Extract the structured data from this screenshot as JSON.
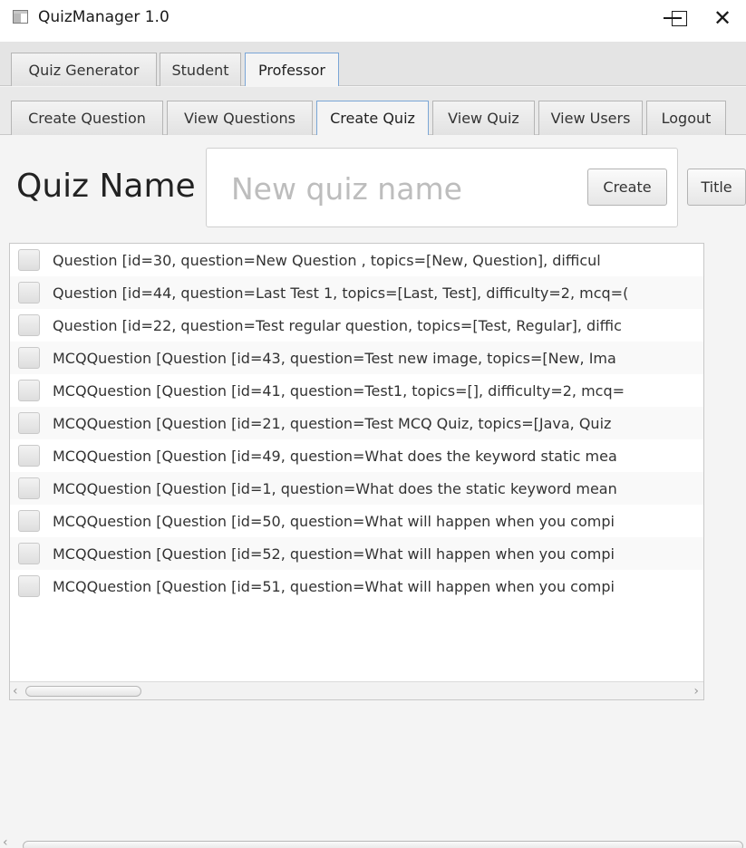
{
  "window": {
    "title": "QuizManager 1.0",
    "minimize": "—",
    "close": "✕"
  },
  "tabs": [
    {
      "label": "Quiz Generator"
    },
    {
      "label": "Student"
    },
    {
      "label": "Professor"
    }
  ],
  "subtabs": [
    {
      "label": "Create Question"
    },
    {
      "label": "View Questions"
    },
    {
      "label": "Create Quiz"
    },
    {
      "label": "View Quiz"
    },
    {
      "label": "View Users"
    },
    {
      "label": "Logout"
    }
  ],
  "quiz": {
    "label": "Quiz Name",
    "placeholder": "New quiz name",
    "value": "",
    "create_label": "Create",
    "title_label": "Title"
  },
  "questions": [
    "Question [id=30, question=New Question    , topics=[New, Question], difficul",
    "Question [id=44, question=Last Test 1, topics=[Last, Test], difficulty=2, mcq=(",
    "Question [id=22, question=Test regular question, topics=[Test, Regular], diffic",
    "MCQQuestion [Question [id=43, question=Test new image, topics=[New, Ima",
    "MCQQuestion [Question [id=41, question=Test1, topics=[], difficulty=2, mcq=",
    "MCQQuestion [Question [id=21, question=Test MCQ Quiz, topics=[Java, Quiz",
    "MCQQuestion [Question [id=49, question=What does the keyword static mea",
    "MCQQuestion [Question [id=1, question=What does the static keyword mean",
    "MCQQuestion [Question [id=50, question=What will happen when you compi",
    "MCQQuestion [Question [id=52, question=What will happen when you compi",
    "MCQQuestion [Question [id=51, question=What will happen when you compi"
  ],
  "scroll": {
    "left_arrow": "‹",
    "right_arrow": "›"
  },
  "colors": {
    "selected_tab_border": "#7aa6d6"
  }
}
